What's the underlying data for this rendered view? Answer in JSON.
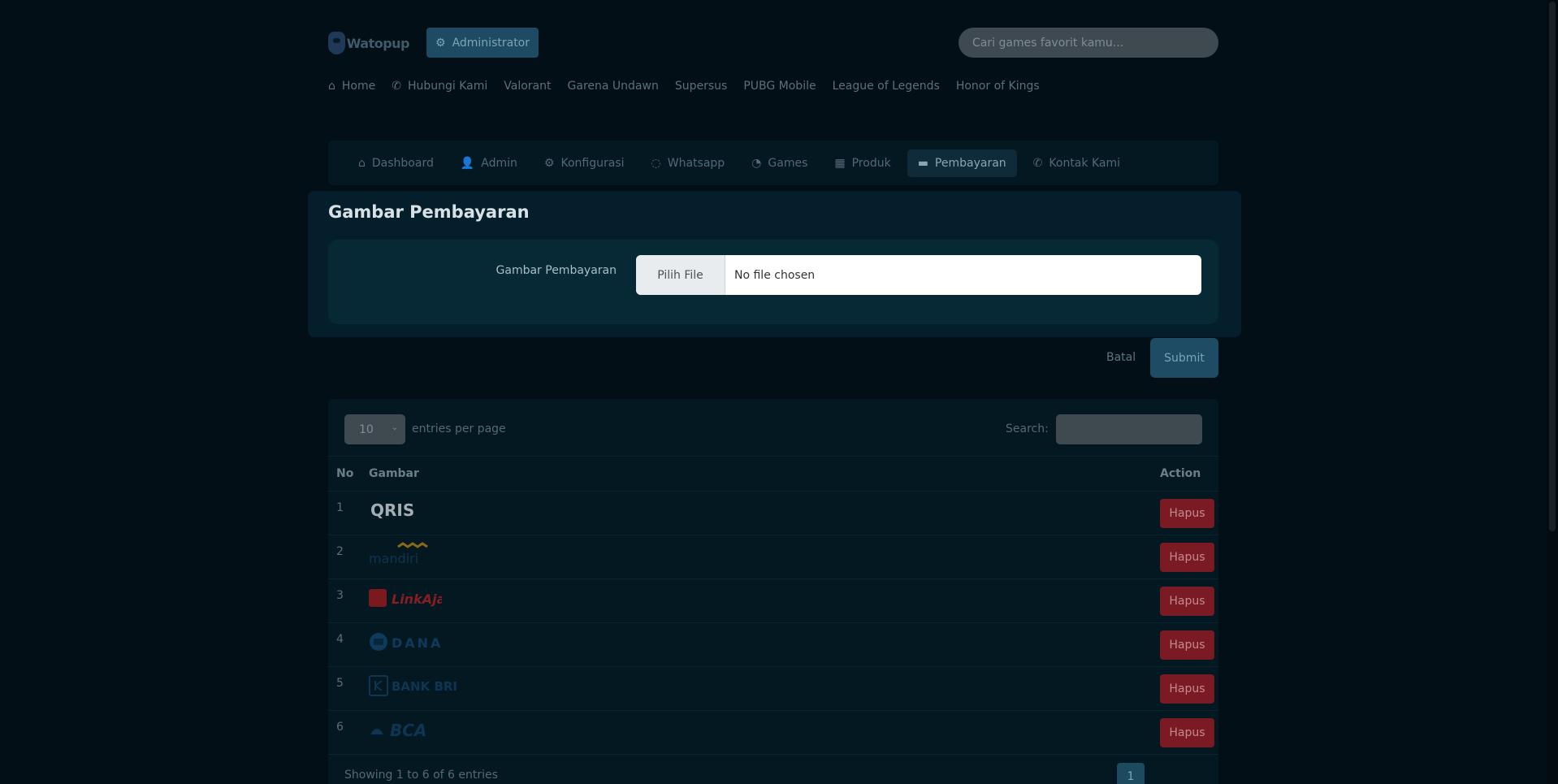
{
  "header": {
    "brand": "Watopup",
    "admin_button": "Administrator",
    "search_placeholder": "Cari games favorit kamu..."
  },
  "main_nav": [
    {
      "label": "Home",
      "icon": "home-icon"
    },
    {
      "label": "Hubungi Kami",
      "icon": "phone-icon"
    },
    {
      "label": "Valorant"
    },
    {
      "label": "Garena Undawn"
    },
    {
      "label": "Supersus"
    },
    {
      "label": "PUBG Mobile"
    },
    {
      "label": "League of Legends"
    },
    {
      "label": "Honor of Kings"
    }
  ],
  "admin_tabs": [
    {
      "label": "Dashboard",
      "icon": "home-icon"
    },
    {
      "label": "Admin",
      "icon": "user-icon"
    },
    {
      "label": "Konfigurasi",
      "icon": "gear-icon"
    },
    {
      "label": "Whatsapp",
      "icon": "whatsapp-icon"
    },
    {
      "label": "Games",
      "icon": "gamepad-icon"
    },
    {
      "label": "Produk",
      "icon": "box-icon"
    },
    {
      "label": "Pembayaran",
      "icon": "credit-card-icon",
      "active": true
    },
    {
      "label": "Kontak Kami",
      "icon": "phone-icon"
    }
  ],
  "form": {
    "title": "Gambar Pembayaran",
    "field_label": "Gambar Pembayaran",
    "choose_file": "Pilih File",
    "file_status": "No file chosen",
    "cancel": "Batal",
    "submit": "Submit"
  },
  "table": {
    "per_page_value": "10",
    "per_page_label": "entries per page",
    "search_label": "Search:",
    "columns": [
      "No",
      "Gambar",
      "Action"
    ],
    "rows": [
      {
        "no": "1",
        "logo": "QRIS",
        "action": "Hapus"
      },
      {
        "no": "2",
        "logo": "mandiri",
        "action": "Hapus"
      },
      {
        "no": "3",
        "logo": "LinkAja",
        "action": "Hapus"
      },
      {
        "no": "4",
        "logo": "DANA",
        "action": "Hapus"
      },
      {
        "no": "5",
        "logo": "BANK BRI",
        "action": "Hapus"
      },
      {
        "no": "6",
        "logo": "BCA",
        "action": "Hapus"
      }
    ],
    "footer": "Showing 1 to 6 of 6 entries",
    "current_page": "1"
  },
  "colors": {
    "background": "#020f16",
    "accent": "#1e4a63",
    "danger": "#7a1a22"
  }
}
